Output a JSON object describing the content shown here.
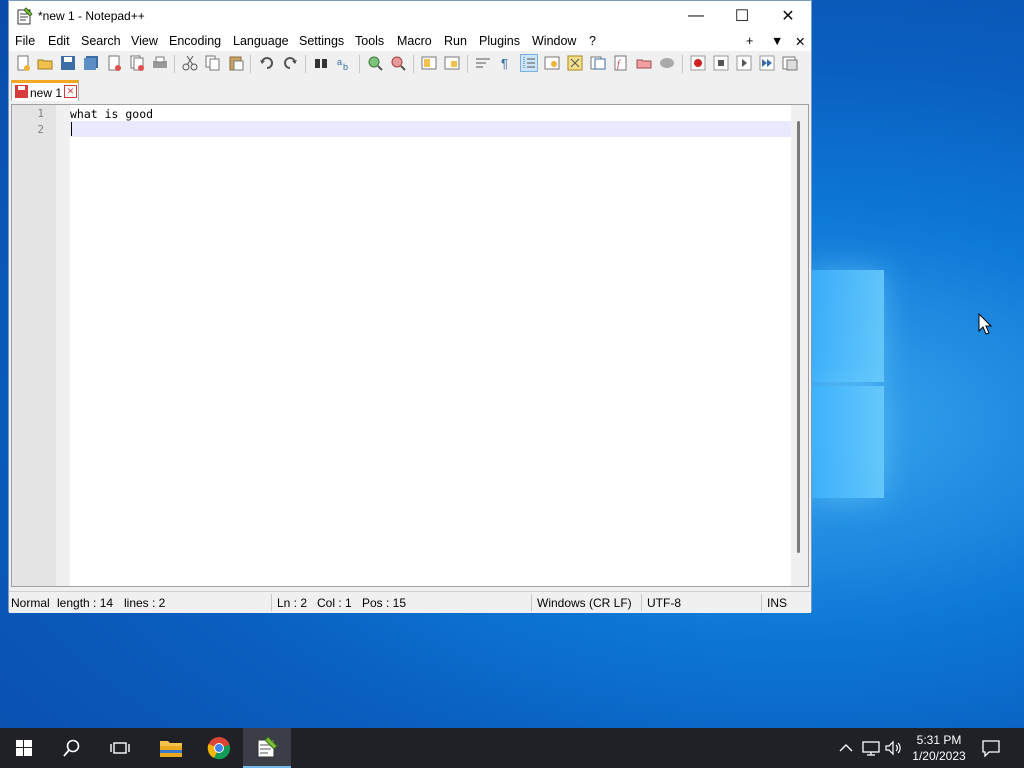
{
  "window": {
    "title": "*new 1 - Notepad++",
    "controls": {
      "minimize": "—",
      "maximize": "☐",
      "close": "✕"
    }
  },
  "menu": {
    "items": [
      "File",
      "Edit",
      "Search",
      "View",
      "Encoding",
      "Language",
      "Settings",
      "Tools",
      "Macro",
      "Run",
      "Plugins",
      "Window",
      "?"
    ],
    "right_controls": [
      "+",
      "▼",
      "✕"
    ]
  },
  "toolbar": {
    "icons": [
      "new-file-icon",
      "open-file-icon",
      "save-icon",
      "save-all-icon",
      "close-icon",
      "close-all-icon",
      "print-icon",
      "cut-icon",
      "copy-icon",
      "paste-icon",
      "undo-icon",
      "redo-icon",
      "find-icon",
      "replace-icon",
      "zoom-in-icon",
      "zoom-out-icon",
      "sync-vertical-icon",
      "sync-horizontal-icon",
      "word-wrap-icon",
      "show-all-chars-icon",
      "indent-guide-icon",
      "udl-icon",
      "doc-map-icon",
      "function-list-icon",
      "folder-workspace-icon",
      "monitoring-icon",
      "record-macro-icon",
      "stop-record-icon",
      "play-macro-icon",
      "run-macro-multiple-icon",
      "save-macro-icon"
    ]
  },
  "tab": {
    "label": "new 1",
    "close": "✕"
  },
  "editor": {
    "lines": [
      {
        "number": "1",
        "text": "what is good"
      },
      {
        "number": "2",
        "text": ""
      }
    ]
  },
  "status": {
    "mode": "Normal",
    "length": "length : 14",
    "lines": "lines : 2",
    "ln": "Ln : 2",
    "col": "Col : 1",
    "pos": "Pos : 15",
    "eol": "Windows (CR LF)",
    "encoding": "UTF-8",
    "ins": "INS"
  },
  "taskbar": {
    "buttons": [
      "start-button",
      "search-button",
      "task-view-button",
      "file-explorer-button",
      "chrome-button",
      "notepadpp-button"
    ],
    "clock_time": "5:31 PM",
    "clock_date": "1/20/2023"
  },
  "colors": {
    "desktop": "#0a5fc0",
    "taskbar": "#1f2127",
    "accent": "#76b9ed"
  }
}
